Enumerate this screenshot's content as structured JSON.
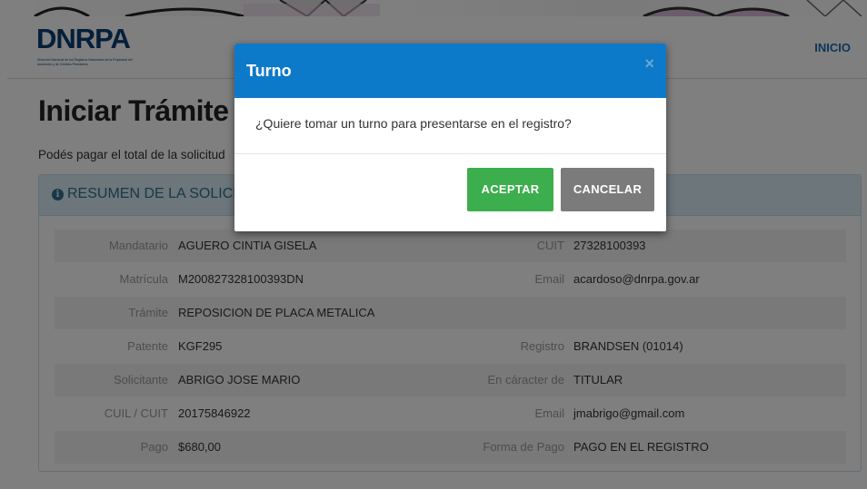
{
  "header": {
    "logo_text": "DNRPA",
    "logo_subtitle": "Dirección Nacional de los Registros Nacionales de la Propiedad del Automotor y de Créditos Prendarios",
    "nav_link": "INICIO"
  },
  "main": {
    "title": "Iniciar Trámite C",
    "intro": "Podés pagar el total de la solicitud",
    "panel_title": "RESUMEN DE LA SOLICITUD"
  },
  "summary": {
    "rows": [
      {
        "label1": "Mandatario",
        "value1": "AGUERO CINTIA GISELA",
        "label2": "CUIT",
        "value2": "27328100393"
      },
      {
        "label1": "Matrícula",
        "value1": "M200827328100393DN",
        "label2": "Email",
        "value2": "acardoso@dnrpa.gov.ar"
      },
      {
        "label1": "Trámite",
        "value1": "REPOSICION DE PLACA METALICA",
        "label2": "",
        "value2": ""
      },
      {
        "label1": "Patente",
        "value1": "KGF295",
        "label2": "Registro",
        "value2": "BRANDSEN (01014)"
      },
      {
        "label1": "Solicitante",
        "value1": "ABRIGO JOSE MARIO",
        "label2": "En cáracter de",
        "value2": "TITULAR"
      },
      {
        "label1": "CUIL / CUIT",
        "value1": "20175846922",
        "label2": "Email",
        "value2": "jmabrigo@gmail.com"
      },
      {
        "label1": "Pago",
        "value1": "$680,00",
        "label2": "Forma de Pago",
        "value2": "PAGO EN EL REGISTRO"
      }
    ]
  },
  "modal": {
    "title": "Turno",
    "close_glyph": "×",
    "message": "¿Quiere tomar un turno para presentarse en el registro?",
    "accept_label": "ACEPTAR",
    "cancel_label": "CANCELAR"
  },
  "colors": {
    "modal_header": "#0d79c9",
    "accept_button": "#3dae4d",
    "cancel_button": "#7b7b7b",
    "panel_heading": "#d9edf7",
    "brand": "#0b3f74"
  },
  "icons": [
    "info-circle-icon",
    "close-icon"
  ]
}
